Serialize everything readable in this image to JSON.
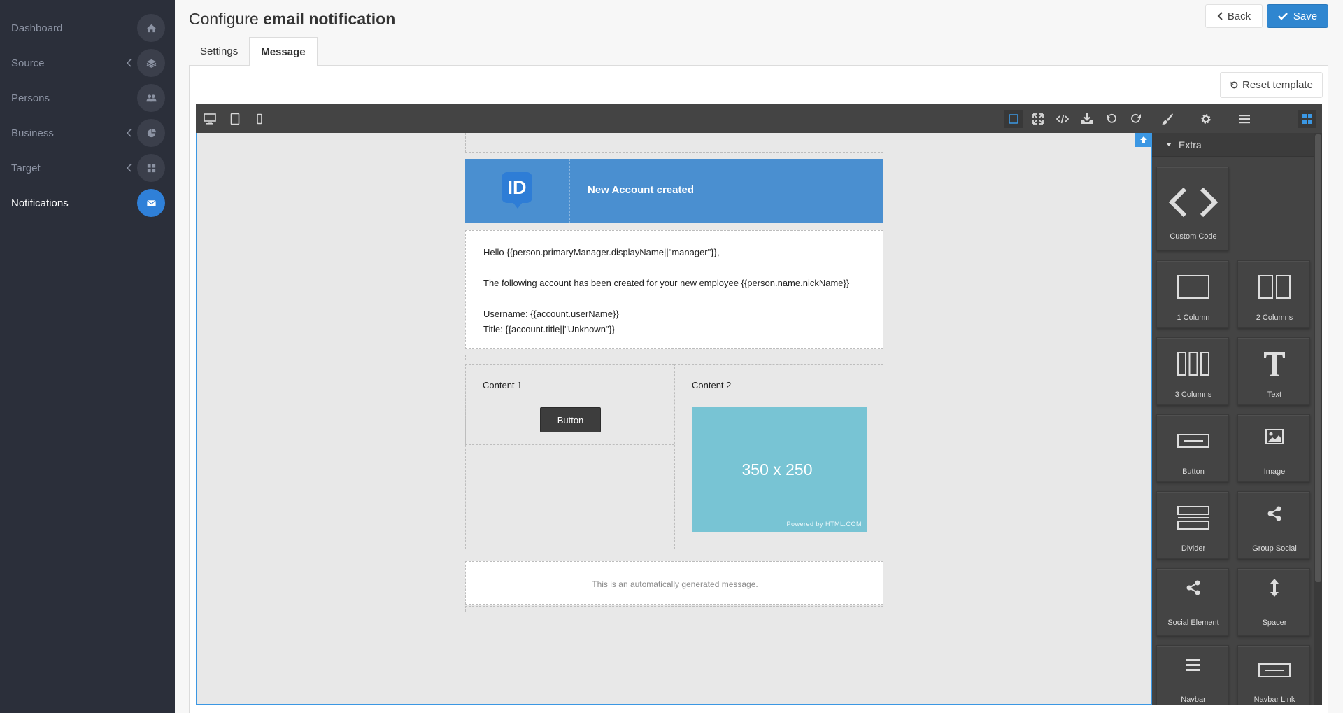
{
  "sidebar": {
    "items": [
      {
        "label": "Dashboard",
        "icon": "home-icon"
      },
      {
        "label": "Source",
        "icon": "layers-icon"
      },
      {
        "label": "Persons",
        "icon": "users-icon"
      },
      {
        "label": "Business",
        "icon": "pie-chart-icon"
      },
      {
        "label": "Target",
        "icon": "grid-icon"
      },
      {
        "label": "Notifications",
        "icon": "envelope-icon"
      }
    ]
  },
  "header": {
    "title_prefix": "Configure",
    "title_bold": "email notification",
    "back_label": "Back",
    "save_label": "Save"
  },
  "tabs": [
    {
      "label": "Settings",
      "active": false
    },
    {
      "label": "Message",
      "active": true
    }
  ],
  "reset_label": "Reset template",
  "email": {
    "header_title": "New Account created",
    "logo_text": "ID",
    "body_lines": [
      "Hello {{person.primaryManager.displayName||\"manager\"}},",
      "The following account has been created for your new employee {{person.name.nickName}}",
      "Username: {{account.userName}}",
      "Title: {{account.title||\"Unknown\"}}"
    ],
    "col1_label": "Content 1",
    "col1_button": "Button",
    "col2_label": "Content 2",
    "placeholder_text": "350 x 250",
    "placeholder_powered": "Powered by HTML.COM",
    "footer": "This is an automatically generated message."
  },
  "blocks_panel": {
    "category": "Extra",
    "blocks": [
      {
        "label": "Custom Code",
        "icon": "code-icon"
      },
      {
        "label": "1 Column",
        "icon": "one-column-icon"
      },
      {
        "label": "2 Columns",
        "icon": "two-columns-icon"
      },
      {
        "label": "3 Columns",
        "icon": "three-columns-icon"
      },
      {
        "label": "Text",
        "icon": "text-icon"
      },
      {
        "label": "Button",
        "icon": "button-block-icon"
      },
      {
        "label": "Image",
        "icon": "image-icon"
      },
      {
        "label": "Divider",
        "icon": "divider-icon"
      },
      {
        "label": "Group Social",
        "icon": "share-icon"
      },
      {
        "label": "Social Element",
        "icon": "share-icon"
      },
      {
        "label": "Spacer",
        "icon": "spacer-icon"
      },
      {
        "label": "Navbar",
        "icon": "navbar-icon"
      },
      {
        "label": "Navbar Link",
        "icon": "navbar-link-icon"
      }
    ]
  },
  "colors": {
    "sidebar_bg": "#2b2f3a",
    "accent": "#2f86d0",
    "email_header": "#4a8fd0",
    "editor_dark": "#444444"
  }
}
